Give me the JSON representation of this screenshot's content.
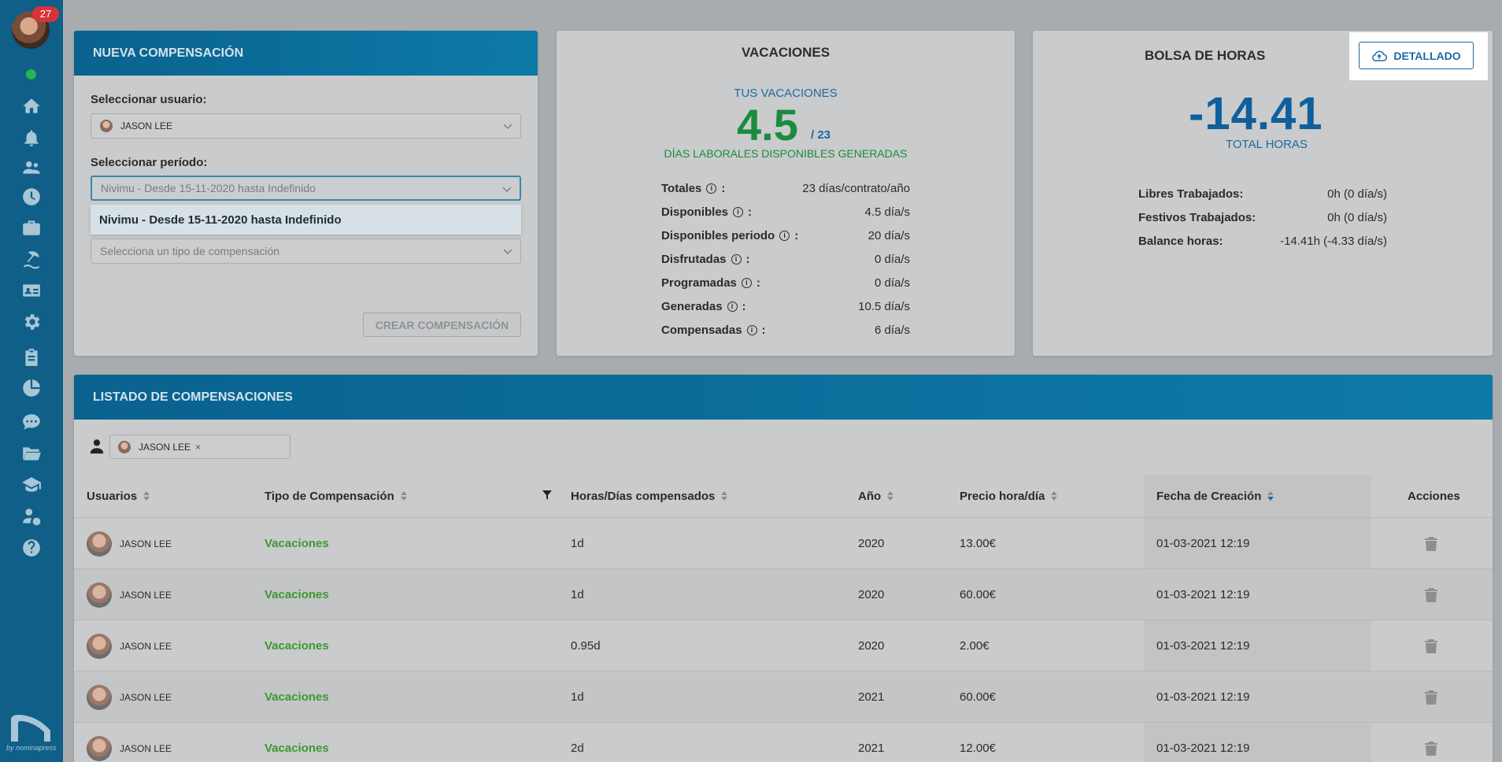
{
  "sidebar": {
    "notification_count": "27",
    "icons": [
      "home-icon",
      "bell-icon",
      "users-icon",
      "clock-icon",
      "briefcase-icon",
      "beach-icon",
      "id-card-icon",
      "gear-icon",
      "clipboard-icon",
      "pie-chart-icon",
      "chat-icon",
      "folder-icon",
      "graduation-cap-icon",
      "user-money-icon",
      "help-icon"
    ],
    "brand_by": "by nominapress"
  },
  "nueva_compensacion": {
    "title": "NUEVA COMPENSACIÓN",
    "user_label": "Seleccionar usuario:",
    "user_value": "JASON LEE",
    "period_label": "Seleccionar período:",
    "period_placeholder": "Nivimu - Desde 15-11-2020 hasta Indefinido",
    "period_option": "Nivimu - Desde 15-11-2020 hasta Indefinido",
    "type_placeholder": "Selecciona un tipo de compensación",
    "create_button": "CREAR COMPENSACIÓN"
  },
  "vacaciones": {
    "title": "VACACIONES",
    "subtitle": "TUS VACACIONES",
    "available": "4.5",
    "total": "/ 23",
    "caption": "DÍAS LABORALES DISPONIBLES GENERADAS",
    "rows": [
      {
        "label": "Totales",
        "value": "23 días/contrato/año"
      },
      {
        "label": "Disponibles",
        "value": "4.5 día/s"
      },
      {
        "label": "Disponibles periodo",
        "value": "20 día/s"
      },
      {
        "label": "Disfrutadas",
        "value": "0 día/s"
      },
      {
        "label": "Programadas",
        "value": "0 día/s"
      },
      {
        "label": "Generadas",
        "value": "10.5 día/s"
      },
      {
        "label": "Compensadas",
        "value": "6 día/s"
      }
    ]
  },
  "bolsa": {
    "title": "BOLSA DE HORAS",
    "detallado_button": "DETALLADO",
    "total": "-14.41",
    "total_caption": "TOTAL HORAS",
    "rows": [
      {
        "label": "Libres Trabajados:",
        "value": "0h (0 día/s)"
      },
      {
        "label": "Festivos Trabajados:",
        "value": "0h (0 día/s)"
      },
      {
        "label": "Balance horas:",
        "value": "-14.41h (-4.33 día/s)"
      }
    ]
  },
  "listado": {
    "title": "LISTADO DE COMPENSACIONES",
    "filter_user": "JASON LEE",
    "columns": [
      "Usuarios",
      "Tipo de Compensación",
      "Horas/Días compensados",
      "Año",
      "Precio hora/día",
      "Fecha de Creación",
      "Acciones"
    ],
    "rows": [
      {
        "user": "JASON LEE",
        "type": "Vacaciones",
        "amount": "1d",
        "year": "2020",
        "price": "13.00€",
        "created": "01-03-2021 12:19"
      },
      {
        "user": "JASON LEE",
        "type": "Vacaciones",
        "amount": "1d",
        "year": "2020",
        "price": "60.00€",
        "created": "01-03-2021 12:19"
      },
      {
        "user": "JASON LEE",
        "type": "Vacaciones",
        "amount": "0.95d",
        "year": "2020",
        "price": "2.00€",
        "created": "01-03-2021 12:19"
      },
      {
        "user": "JASON LEE",
        "type": "Vacaciones",
        "amount": "1d",
        "year": "2021",
        "price": "60.00€",
        "created": "01-03-2021 12:19"
      },
      {
        "user": "JASON LEE",
        "type": "Vacaciones",
        "amount": "2d",
        "year": "2021",
        "price": "12.00€",
        "created": "01-03-2021 12:19"
      }
    ]
  }
}
